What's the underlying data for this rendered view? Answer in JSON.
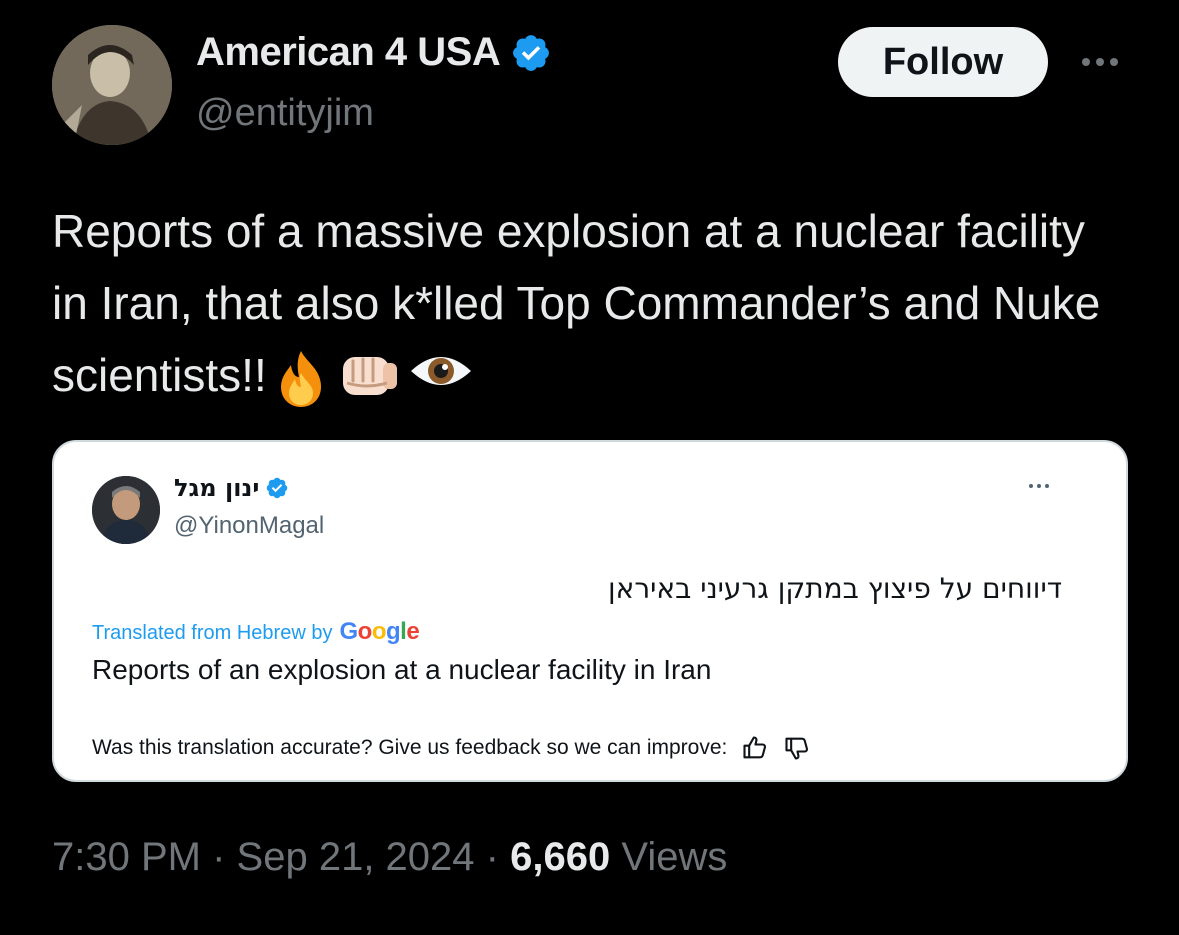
{
  "author": {
    "display_name": "American 4 USA",
    "handle": "@entityjim",
    "verified": true
  },
  "follow_label": "Follow",
  "tweet": {
    "text": "Reports of a massive explosion at a nuclear facility in Iran, that also k*lled Top Commander’s and Nuke scientists!!",
    "emojis": [
      "fire-icon",
      "fist-icon",
      "eye-icon"
    ]
  },
  "quoted": {
    "display_name": "ינון מגל",
    "handle": "@YinonMagal",
    "verified": true,
    "original_text": "דיווחים על פיצוץ במתקן גרעיני באיראן",
    "translated_label": "Translated from Hebrew by",
    "translator": "Google",
    "translation": "Reports of an explosion at a nuclear facility in Iran",
    "feedback_prompt": "Was this translation accurate? Give us feedback so we can improve:"
  },
  "meta": {
    "time": "7:30 PM",
    "sep1": "·",
    "date": "Sep 21, 2024",
    "sep2": "·",
    "views_count": "6,660",
    "views_label": "Views"
  },
  "colors": {
    "background": "#000000",
    "text": "#e7e9ea",
    "secondary": "#71767b",
    "accent": "#1d9bf0"
  }
}
